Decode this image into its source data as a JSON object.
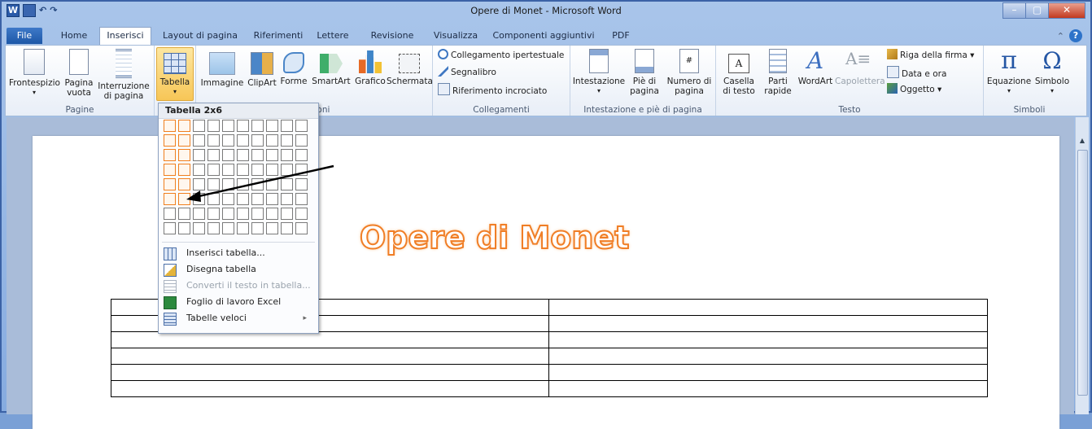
{
  "window": {
    "title": "Opere di Monet - Microsoft Word",
    "logo": "W",
    "undo_glyph": "↶",
    "redo_glyph": "↷",
    "minimize": "–",
    "maximize": "▢",
    "close": "✕"
  },
  "tabs": {
    "file": "File",
    "home": "Home",
    "inserisci": "Inserisci",
    "layout": "Layout di pagina",
    "riferimenti": "Riferimenti",
    "lettere": "Lettere",
    "revisione": "Revisione",
    "visualizza": "Visualizza",
    "componenti": "Componenti aggiuntivi",
    "pdf": "PDF",
    "help": "?"
  },
  "ribbon": {
    "pagine": {
      "label": "Pagine",
      "frontespizio": "Frontespizio",
      "pagina_vuota_1": "Pagina",
      "pagina_vuota_2": "vuota",
      "interruzione_1": "Interruzione",
      "interruzione_2": "di pagina"
    },
    "tabelle": {
      "tabella": "Tabella"
    },
    "illustrazioni": {
      "label_partial": "zioni",
      "immagine": "Immagine",
      "clipart": "ClipArt",
      "forme": "Forme",
      "smartart": "SmartArt",
      "grafico": "Grafico",
      "schermata": "Schermata"
    },
    "collegamenti": {
      "label": "Collegamenti",
      "ipertestuale": "Collegamento ipertestuale",
      "segnalibro": "Segnalibro",
      "incrociato": "Riferimento incrociato"
    },
    "intestazione": {
      "label": "Intestazione e piè di pagina",
      "intestazione": "Intestazione",
      "pie_1": "Piè di",
      "pie_2": "pagina",
      "numero_1": "Numero di",
      "numero_2": "pagina"
    },
    "testo": {
      "label": "Testo",
      "casella_1": "Casella",
      "casella_2": "di testo",
      "parti_1": "Parti",
      "parti_2": "rapide",
      "wordart": "WordArt",
      "capolettera": "Capolettera",
      "riga_firma": "Riga della firma",
      "data_ora": "Data e ora",
      "oggetto": "Oggetto"
    },
    "simboli": {
      "label": "Simboli",
      "equazione": "Equazione",
      "simbolo": "Simbolo",
      "pi": "π",
      "omega": "Ω"
    }
  },
  "dropdown": {
    "header": "Tabella 2x6",
    "grid_cols": 10,
    "grid_rows": 8,
    "selected_cols": 2,
    "selected_rows": 6,
    "items": [
      {
        "label": "Inserisci tabella...",
        "enabled": true
      },
      {
        "label": "Disegna tabella",
        "enabled": true
      },
      {
        "label": "Converti il testo in tabella...",
        "enabled": false
      },
      {
        "label": "Foglio di lavoro Excel",
        "enabled": true
      },
      {
        "label": "Tabelle veloci",
        "enabled": true,
        "submenu": "▸"
      }
    ]
  },
  "document": {
    "title": "Opere di Monet",
    "table_rows": 6,
    "table_cols": 2
  },
  "colors": {
    "title_orange": "#f07e26",
    "selected_cell": "#f07f1e",
    "ribbon_blue": "#2a5aa8"
  }
}
